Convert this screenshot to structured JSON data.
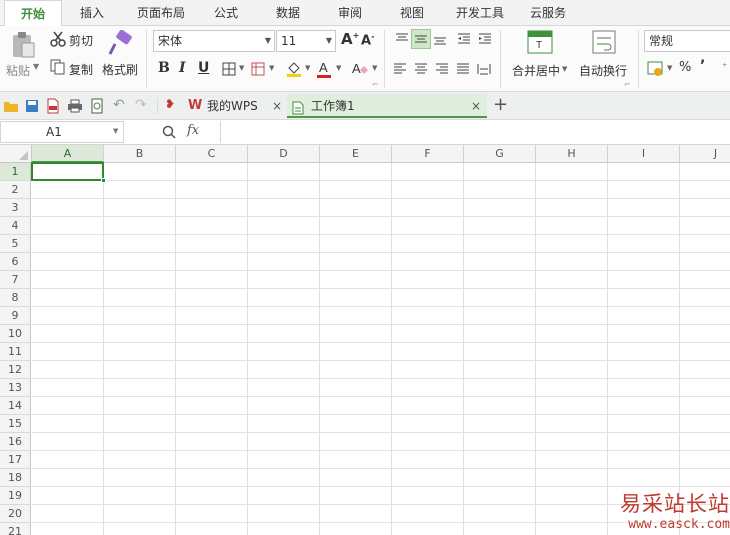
{
  "menu": {
    "tabs": [
      "开始",
      "插入",
      "页面布局",
      "公式",
      "数据",
      "审阅",
      "视图",
      "开发工具",
      "云服务"
    ],
    "active": "开始"
  },
  "ribbon": {
    "paste_label": "粘贴",
    "cut_label": "剪切",
    "copy_label": "复制",
    "format_painter_label": "格式刷",
    "font_name": "宋体",
    "font_size": "11",
    "merge_center_label": "合并居中",
    "wrap_text_label": "自动换行",
    "number_format": "常规",
    "bold": "B",
    "italic": "I",
    "underline": "U",
    "percent": "%",
    "comma": "’"
  },
  "quickbar": {
    "tabs": [
      {
        "label": "我的WPS",
        "icon": "wps-logo-icon"
      },
      {
        "label": "工作簿1",
        "icon": "spreadsheet-icon"
      }
    ],
    "close_glyph": "×",
    "add_glyph": "+"
  },
  "formula_bar": {
    "name_box": "A1",
    "fx_label": "fx",
    "formula": ""
  },
  "sheet": {
    "columns": [
      "A",
      "B",
      "C",
      "D",
      "E",
      "F",
      "G",
      "H",
      "I",
      "J"
    ],
    "rows": [
      "1",
      "2",
      "3",
      "4",
      "5",
      "6",
      "7",
      "8",
      "9",
      "10",
      "11",
      "12",
      "13",
      "14",
      "15",
      "16",
      "17",
      "18",
      "19",
      "20",
      "21"
    ],
    "selected_cell": "A1"
  },
  "watermark": {
    "title": "易采站长站",
    "url": "www.easck.com"
  },
  "colors": {
    "accent_green": "#3f8f3f",
    "selection_border": "#2f8a2f",
    "watermark_red": "#c0392b"
  }
}
